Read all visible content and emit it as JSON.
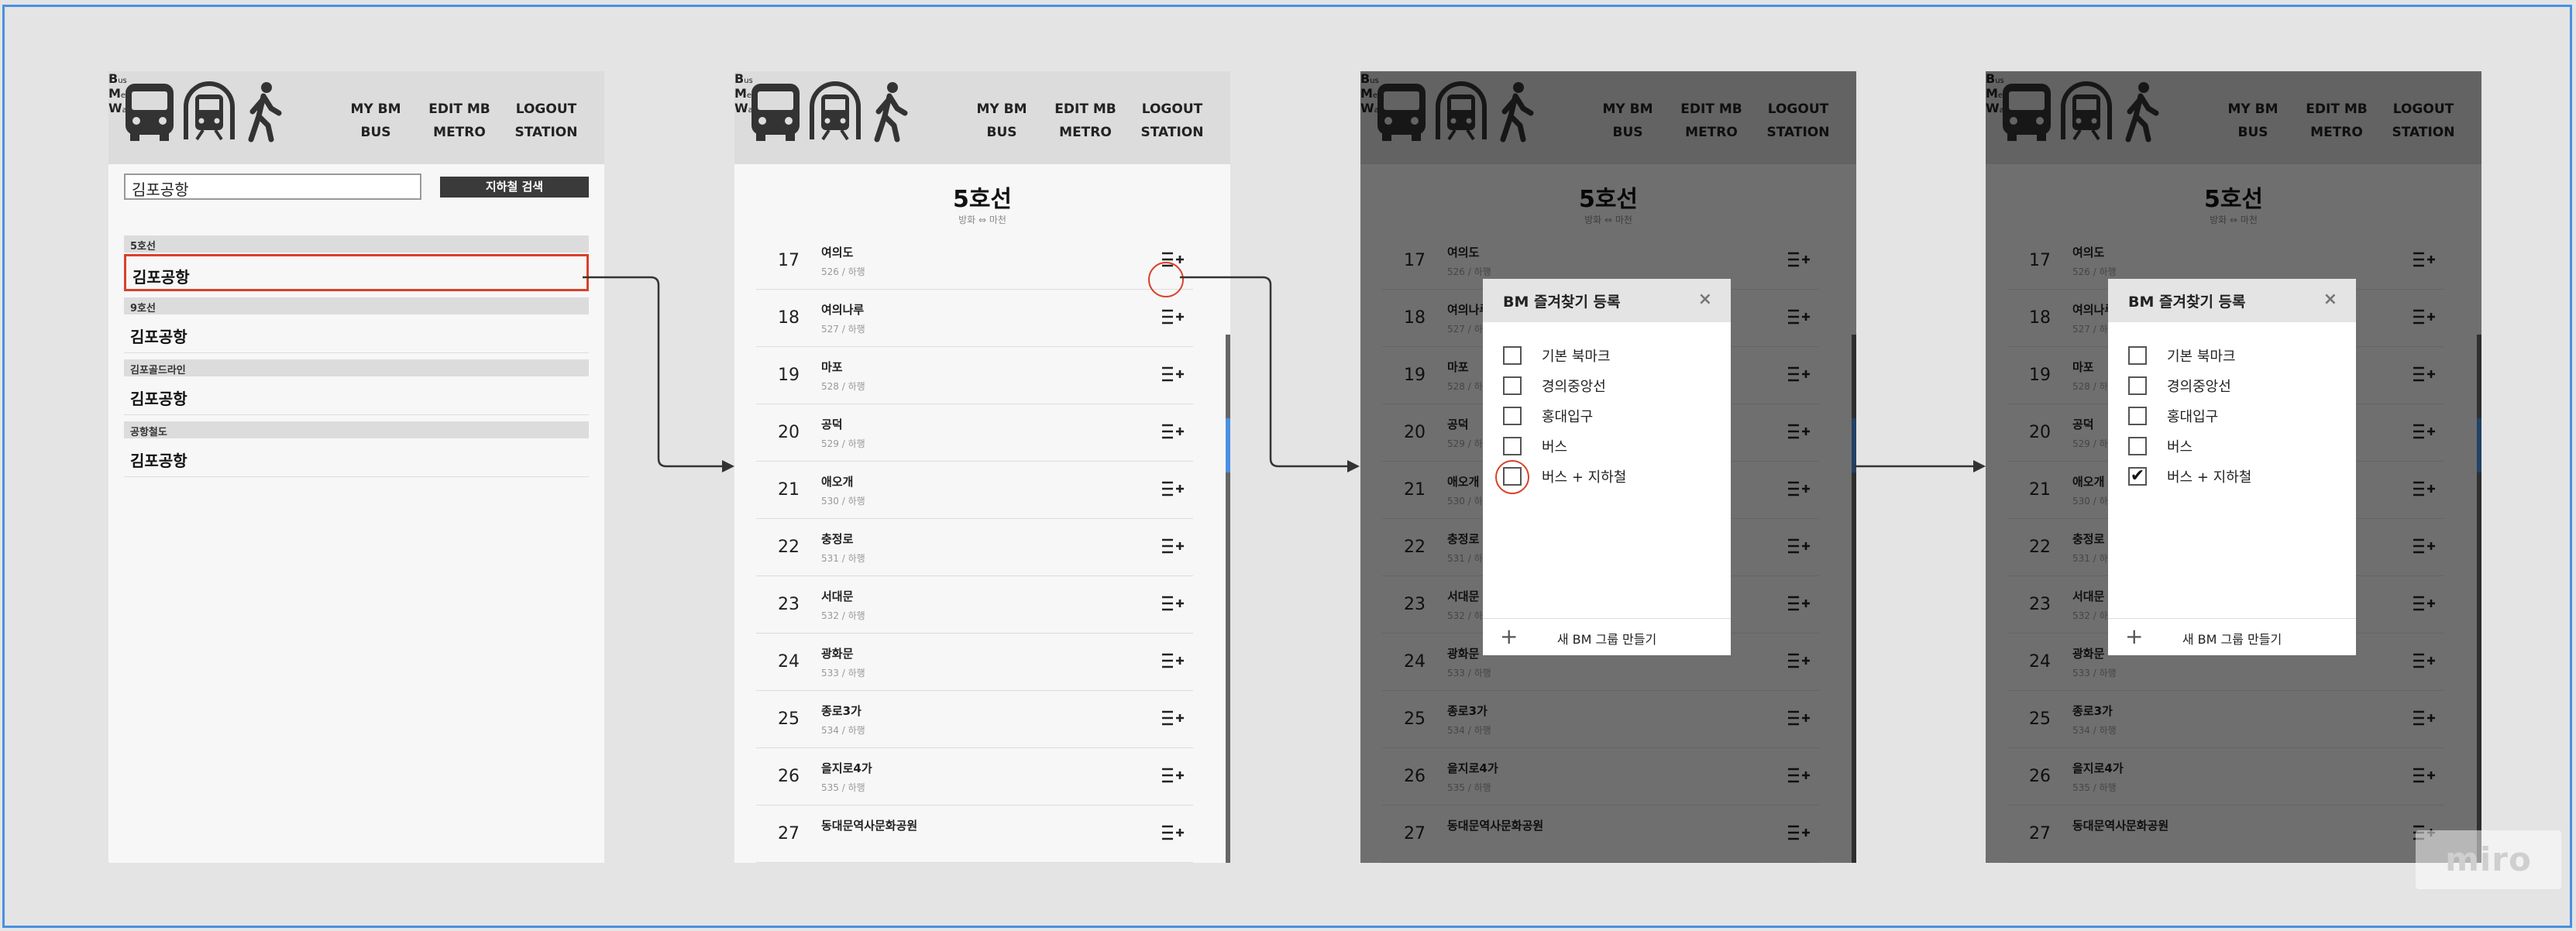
{
  "app": {
    "logo_caption_letters": [
      "B",
      "us",
      "M",
      "etro",
      "W",
      "alk"
    ],
    "nav": [
      {
        "line1": "MY BM",
        "line2": "BUS"
      },
      {
        "line1": "EDIT MB",
        "line2": "METRO"
      },
      {
        "line1": "LOGOUT",
        "line2": "STATION"
      }
    ],
    "colors": {
      "accent_red": "#d9412a",
      "highlight_blue": "#4a90e2",
      "header_gray": "#dcdcdc"
    }
  },
  "search_screen": {
    "input_value": "김포공항",
    "search_button": "지하철 검색",
    "results": [
      {
        "line": "5호선",
        "station": "김포공항"
      },
      {
        "line": "9호선",
        "station": "김포공항"
      },
      {
        "line": "김포골드라인",
        "station": "김포공항"
      },
      {
        "line": "공항철도",
        "station": "김포공항"
      }
    ]
  },
  "line_screen": {
    "title": "5호선",
    "subtitle": "방화 ⇔ 마천",
    "stations": [
      {
        "num": "17",
        "name": "여의도",
        "sub": "526 / 하행"
      },
      {
        "num": "18",
        "name": "여의나루",
        "sub": "527 / 하행"
      },
      {
        "num": "19",
        "name": "마포",
        "sub": "528 / 하행"
      },
      {
        "num": "20",
        "name": "공덕",
        "sub": "529 / 하행"
      },
      {
        "num": "21",
        "name": "애오개",
        "sub": "530 / 하행"
      },
      {
        "num": "22",
        "name": "충정로",
        "sub": "531 / 하행"
      },
      {
        "num": "23",
        "name": "서대문",
        "sub": "532 / 하행"
      },
      {
        "num": "24",
        "name": "광화문",
        "sub": "533 / 하행"
      },
      {
        "num": "25",
        "name": "종로3가",
        "sub": "534 / 하행"
      },
      {
        "num": "26",
        "name": "을지로4가",
        "sub": "535 / 하행"
      },
      {
        "num": "27",
        "name": "동대문역사문화공원",
        "sub": ""
      }
    ],
    "add_icon": "list-add-icon"
  },
  "modal": {
    "title": "BM 즐겨찾기 등록",
    "close": "×",
    "options": [
      "기본 북마크",
      "경의중앙선",
      "홍대입구",
      "버스",
      "버스 + 지하철"
    ],
    "checkmark": "✔",
    "checked_index_screen4": 4,
    "footer_plus": "+",
    "footer_label": "새 BM 그룹 만들기"
  },
  "watermark": "miro"
}
